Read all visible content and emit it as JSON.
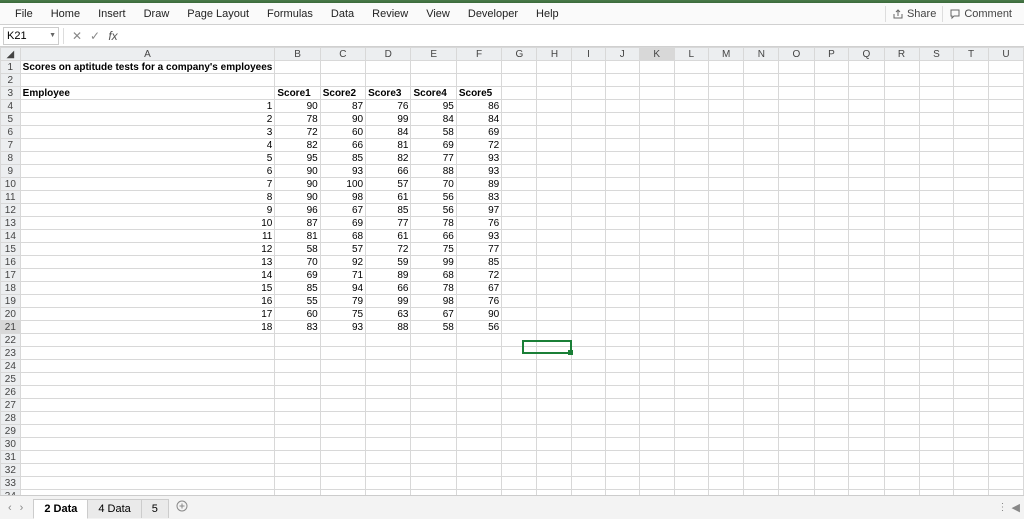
{
  "ribbon": {
    "tabs": [
      "File",
      "Home",
      "Insert",
      "Draw",
      "Page Layout",
      "Formulas",
      "Data",
      "Review",
      "View",
      "Developer",
      "Help"
    ],
    "share": "Share",
    "comment": "Comment"
  },
  "formula_bar": {
    "cell_ref": "K21",
    "fx_label": "fx",
    "value": ""
  },
  "columns": [
    "A",
    "B",
    "C",
    "D",
    "E",
    "F",
    "G",
    "H",
    "I",
    "J",
    "K",
    "L",
    "M",
    "N",
    "O",
    "P",
    "Q",
    "R",
    "S",
    "T",
    "U"
  ],
  "row_count": 34,
  "title_row": {
    "text": "Scores on aptitude tests for a company's employees"
  },
  "header_row": [
    "Employee",
    "Score1",
    "Score2",
    "Score3",
    "Score4",
    "Score5"
  ],
  "chart_data": {
    "type": "table",
    "title": "Scores on aptitude tests for a company's employees",
    "columns": [
      "Employee",
      "Score1",
      "Score2",
      "Score3",
      "Score4",
      "Score5"
    ],
    "rows": [
      [
        1,
        90,
        87,
        76,
        95,
        86
      ],
      [
        2,
        78,
        90,
        99,
        84,
        84
      ],
      [
        3,
        72,
        60,
        84,
        58,
        69
      ],
      [
        4,
        82,
        66,
        81,
        69,
        72
      ],
      [
        5,
        95,
        85,
        82,
        77,
        93
      ],
      [
        6,
        90,
        93,
        66,
        88,
        93
      ],
      [
        7,
        90,
        100,
        57,
        70,
        89
      ],
      [
        8,
        90,
        98,
        61,
        56,
        83
      ],
      [
        9,
        96,
        67,
        85,
        56,
        97
      ],
      [
        10,
        87,
        69,
        77,
        78,
        76
      ],
      [
        11,
        81,
        68,
        61,
        66,
        93
      ],
      [
        12,
        58,
        57,
        72,
        75,
        77
      ],
      [
        13,
        70,
        92,
        59,
        99,
        85
      ],
      [
        14,
        69,
        71,
        89,
        68,
        72
      ],
      [
        15,
        85,
        94,
        66,
        78,
        67
      ],
      [
        16,
        55,
        79,
        99,
        98,
        76
      ],
      [
        17,
        60,
        75,
        63,
        67,
        90
      ],
      [
        18,
        83,
        93,
        88,
        58,
        56
      ]
    ]
  },
  "selection": {
    "row": 21,
    "col": "K",
    "col_index": 10
  },
  "sheets": {
    "nav_prev": "‹",
    "nav_next": "›",
    "tabs": [
      {
        "label": "2 Data",
        "active": true
      },
      {
        "label": "4 Data",
        "active": false
      },
      {
        "label": "5",
        "active": false
      }
    ],
    "add": "+"
  }
}
